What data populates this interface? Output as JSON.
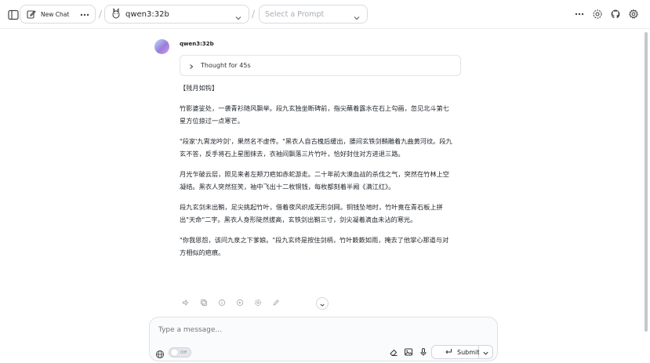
{
  "header": {
    "new_chat_label": "New Chat",
    "model_name": "qwen3:32b",
    "separator": "/",
    "prompt_placeholder": "Select a Prompt"
  },
  "message": {
    "model": "qwen3:32b",
    "thought_label": "Thought for 45s",
    "title": "【残月如钩】",
    "paragraphs": [
      "竹影婆娑处，一袭青衫随风飘举。段九玄独坐断碑前，指尖蘸着露水在石上勾画，忽见北斗第七星方位掠过一点寒芒。",
      "\"段家'九霄龙吟剑'，果然名不虚传。\"黑衣人自古槐后缓出，腰间玄铁剑鞘雕着九曲黄河纹。段九玄不答，反手将石上星图抹去，衣袖间飘落三片竹叶，恰好封住对方进退三路。",
      "月光乍破云层，照见来者左颊刀疤如赤蛇游走。二十年前大漠血战的杀伐之气，突然在竹林上空凝结。黑衣人突然狂笑，袖中飞出十二枚铜钱，每枚都刻着半阙《满江红》。",
      "段九玄剑未出鞘，足尖挑起竹叶，借着夜风织成无形剑网。铜钱坠地时，竹叶竟在青石板上拼出\"天命\"二字。黑衣人身形陡然拔高，玄铁剑出鞘三寸，剑尖凝着滴血未沾的寒光。",
      "\"你我恩怨，该问九泉之下爹娘。\"段九玄终是按住剑柄，竹叶簌簌如雨，掩去了他掌心那道与对方相似的疤痕。"
    ]
  },
  "composer": {
    "placeholder": "Type a message...",
    "toggle_label": "Off",
    "submit_label": "Submit"
  },
  "colors": {
    "border": "#d7dbe0",
    "text": "#24292f",
    "muted": "#8d939a"
  }
}
